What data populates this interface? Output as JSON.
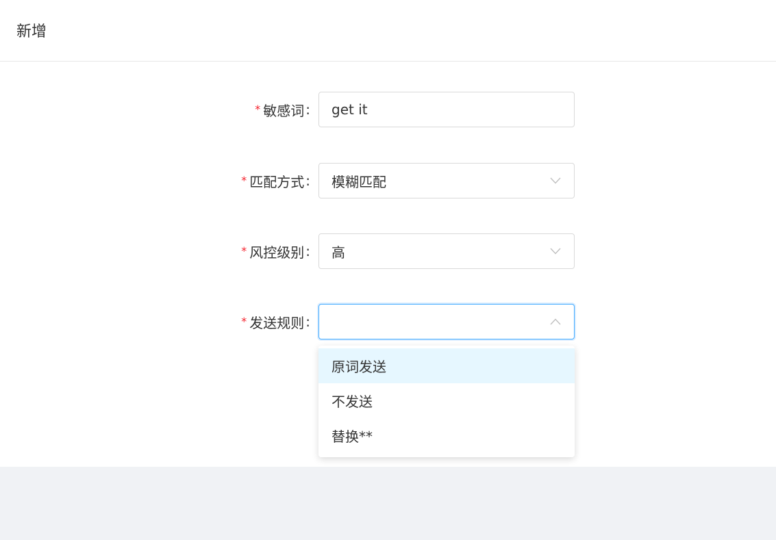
{
  "header": {
    "title": "新增"
  },
  "form": {
    "required_mark": "*",
    "colon": ":",
    "fields": [
      {
        "label": "敏感词",
        "value": "get it",
        "type": "text"
      },
      {
        "label": "匹配方式",
        "value": "模糊匹配",
        "type": "select"
      },
      {
        "label": "风控级别",
        "value": "高",
        "type": "select"
      },
      {
        "label": "发送规则",
        "value": "",
        "type": "select",
        "open": true
      }
    ]
  },
  "dropdown": {
    "options": [
      "原词发送",
      "不发送",
      "替换**"
    ],
    "highlighted_index": 0
  },
  "colors": {
    "required": "#f5222d",
    "focus_border": "#40a9ff",
    "option_highlight": "#e6f7ff",
    "page_background": "#f0f2f5"
  },
  "icons": {
    "select_closed": "chevron-down-icon",
    "select_open": "chevron-up-icon"
  }
}
